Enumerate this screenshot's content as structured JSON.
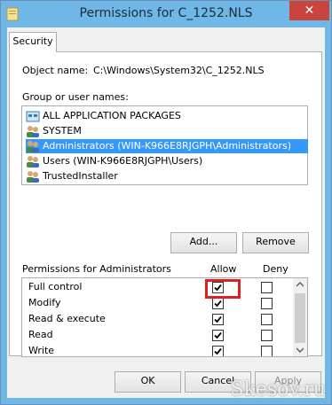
{
  "window": {
    "title": "Permissions for C_1252.NLS",
    "close_glyph": "✕"
  },
  "tab": {
    "label": "Security"
  },
  "object": {
    "label": "Object name:",
    "value": "C:\\Windows\\System32\\C_1252.NLS"
  },
  "groups": {
    "label": "Group or user names:",
    "items": [
      {
        "label": "ALL APPLICATION PACKAGES",
        "icon": "packages-icon"
      },
      {
        "label": "SYSTEM",
        "icon": "user-group-icon"
      },
      {
        "label": "Administrators (WIN-K966E8RJGPH\\Administrators)",
        "icon": "user-group-icon",
        "selected": true
      },
      {
        "label": "Users (WIN-K966E8RJGPH\\Users)",
        "icon": "user-group-icon"
      },
      {
        "label": "TrustedInstaller",
        "icon": "user-group-icon"
      }
    ]
  },
  "buttons": {
    "add": "Add...",
    "remove": "Remove",
    "ok": "OK",
    "cancel": "Cancel",
    "apply": "Apply"
  },
  "permissions": {
    "label": "Permissions for Administrators",
    "allow_header": "Allow",
    "deny_header": "Deny",
    "rows": [
      {
        "name": "Full control",
        "allow": true,
        "deny": false
      },
      {
        "name": "Modify",
        "allow": true,
        "deny": false
      },
      {
        "name": "Read & execute",
        "allow": true,
        "deny": false
      },
      {
        "name": "Read",
        "allow": true,
        "deny": false
      },
      {
        "name": "Write",
        "allow": true,
        "deny": false
      }
    ]
  },
  "watermark": "Skesov.ru",
  "colors": {
    "titlebar": "#6fb7e6",
    "close": "#c9443c",
    "selection": "#3399ff",
    "highlight": "#e02020"
  }
}
